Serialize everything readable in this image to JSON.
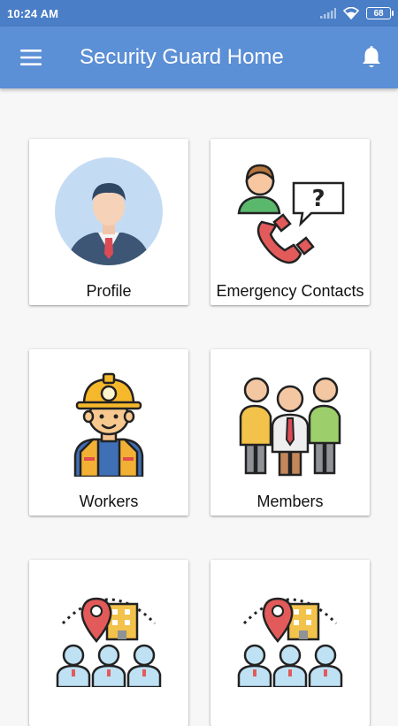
{
  "status_bar": {
    "time": "10:24 AM",
    "battery": "68"
  },
  "app_bar": {
    "title": "Security Guard Home",
    "menu_icon": "hamburger-menu-icon",
    "notification_icon": "bell-icon"
  },
  "menu_cards": [
    {
      "label": "Profile",
      "icon": "profile-icon"
    },
    {
      "label": "Emergency Contacts",
      "icon": "emergency-contacts-icon"
    },
    {
      "label": "Workers",
      "icon": "worker-icon"
    },
    {
      "label": "Members",
      "icon": "members-icon"
    },
    {
      "label": "",
      "icon": "society-location-icon"
    },
    {
      "label": "",
      "icon": "society-location-icon"
    }
  ],
  "colors": {
    "status_bar": "#4a7ec7",
    "app_bar": "#5b8fd6",
    "background": "#f7f7f7"
  }
}
